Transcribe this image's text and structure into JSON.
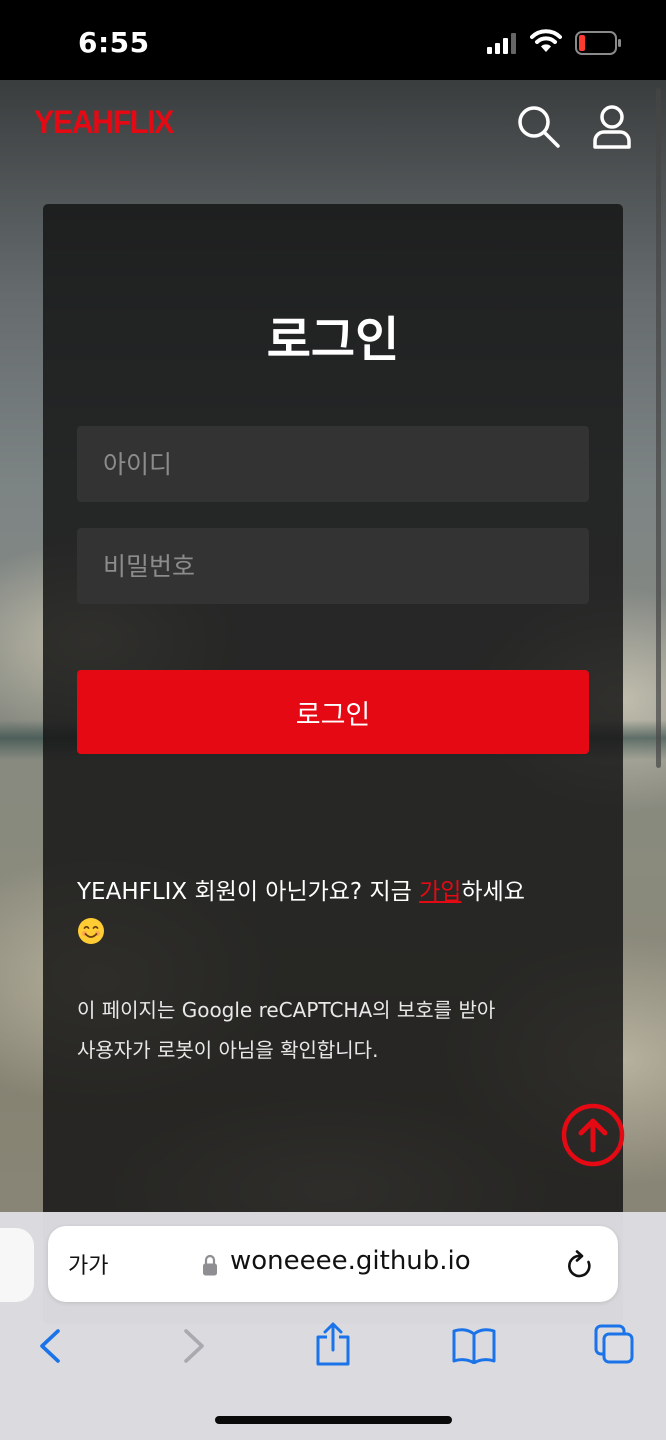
{
  "status_bar": {
    "time": "6:55"
  },
  "site": {
    "logo": "YEAHFLIX",
    "accent_color": "#e50914",
    "header_icons": [
      "search-icon",
      "user-icon"
    ]
  },
  "login": {
    "title": "로그인",
    "id_placeholder": "아이디",
    "password_placeholder": "비밀번호",
    "button_label": "로그인",
    "signup_prefix": "YEAHFLIX 회원이 아닌가요? 지금 ",
    "signup_link": "가입",
    "signup_suffix": "하세요",
    "signup_emoji_icon": "smiling-face-icon",
    "recaptcha_line1": "이 페이지는 Google reCAPTCHA의 보호를 받아",
    "recaptcha_line2": "사용자가 로봇이 아님을 확인합니다."
  },
  "browser": {
    "text_size_label": "가가",
    "url": "woneeee.github.io",
    "toolbar_icons": [
      "back-icon",
      "forward-icon",
      "share-icon",
      "bookmarks-icon",
      "tabs-icon"
    ]
  }
}
